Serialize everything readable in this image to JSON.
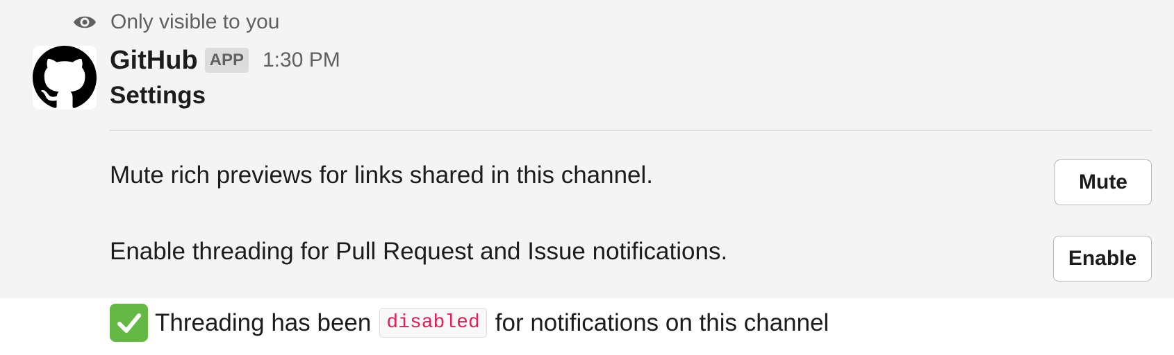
{
  "visibility": {
    "icon": "eye-icon",
    "text": "Only visible to you"
  },
  "message": {
    "sender": "GitHub",
    "badge": "APP",
    "time": "1:30 PM",
    "avatar_icon": "github-octocat-icon",
    "title": "Settings",
    "settings": [
      {
        "text": "Mute rich previews for links shared in this channel.",
        "button": "Mute"
      },
      {
        "text": "Enable threading for Pull Request and Issue notifications.",
        "button": "Enable"
      }
    ]
  },
  "confirmation": {
    "icon": "check-mark-button-icon",
    "before": "Threading has been",
    "code": "disabled",
    "after": "for notifications on this channel"
  },
  "colors": {
    "code_text": "#e01e5a",
    "check_green": "#64b945",
    "message_bg": "#f4f4f4"
  }
}
